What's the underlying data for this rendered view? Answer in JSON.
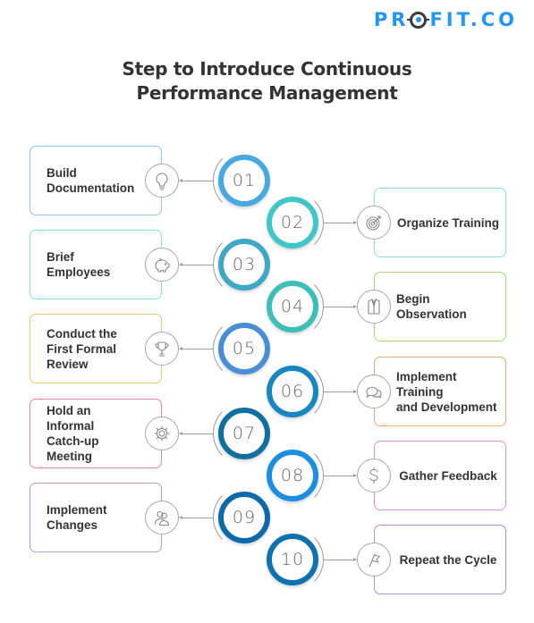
{
  "brand": {
    "logo_prefix": "PR",
    "logo_suffix": "FIT.CO",
    "logo_color": "#2196f3"
  },
  "title": {
    "line1": "Step to Introduce Continuous",
    "line2": "Performance Management"
  },
  "steps": [
    {
      "number": "01",
      "label": "Build\nDocumentation",
      "icon": "lightbulb-icon",
      "side": "left",
      "box_color": "#8ec8ea",
      "ring_color": "#47a9e0"
    },
    {
      "number": "02",
      "label": "Organize Training",
      "icon": "target-icon",
      "side": "right",
      "box_color": "#8fd9e0",
      "ring_color": "#40c6c6"
    },
    {
      "number": "03",
      "label": "Brief Employees",
      "icon": "piggy-bank-icon",
      "side": "left",
      "box_color": "#8ee0c8",
      "ring_color": "#3fa8c6"
    },
    {
      "number": "04",
      "label": "Begin Observation",
      "icon": "suit-icon",
      "side": "right",
      "box_color": "#a8d878",
      "ring_color": "#3bbfb8"
    },
    {
      "number": "05",
      "label": "Conduct the\nFirst Formal Review",
      "icon": "trophy-icon",
      "side": "left",
      "box_color": "#f0c870",
      "ring_color": "#4a8fd6"
    },
    {
      "number": "06",
      "label": "Implement Training\nand Development",
      "icon": "chat-bubbles-icon",
      "side": "right",
      "box_color": "#f0a878",
      "ring_color": "#1a86c0"
    },
    {
      "number": "07",
      "label": "Hold an Informal\nCatch-up Meeting",
      "icon": "gear-icon",
      "side": "left",
      "box_color": "#e88a9a",
      "ring_color": "#0f6f9e"
    },
    {
      "number": "08",
      "label": "Gather Feedback",
      "icon": "dollar-icon",
      "side": "right",
      "box_color": "#e090d8",
      "ring_color": "#1c8ee0"
    },
    {
      "number": "09",
      "label": "Implement Changes",
      "icon": "users-icon",
      "side": "left",
      "box_color": "#b49ae8",
      "ring_color": "#0d6aa8"
    },
    {
      "number": "10",
      "label": "Repeat the Cycle",
      "icon": "flag-icon",
      "side": "right",
      "box_color": "#9a9ae8",
      "ring_color": "#0f72b0"
    }
  ]
}
